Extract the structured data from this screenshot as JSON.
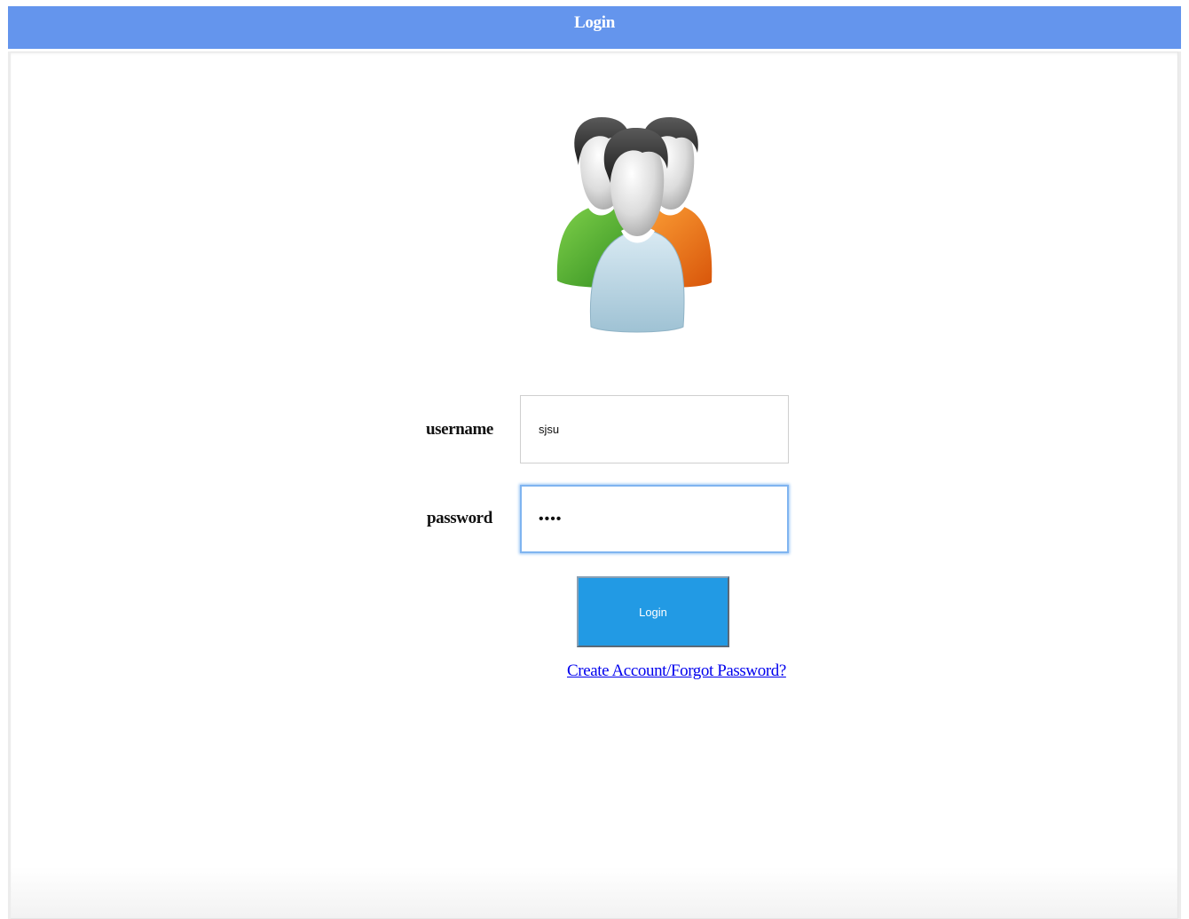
{
  "header": {
    "title": "Login"
  },
  "form": {
    "username_label": "username",
    "username_value": "sjsu",
    "password_label": "password",
    "password_value": "••••",
    "login_button_label": "Login",
    "account_link_text": "Create Account/Forgot Password?"
  },
  "icons": {
    "avatar": "user-group-icon"
  },
  "colors": {
    "header_bg": "#6495ed",
    "button_bg": "#229ae4",
    "link": "#0000ee",
    "focus_ring": "#7fb4f0"
  }
}
